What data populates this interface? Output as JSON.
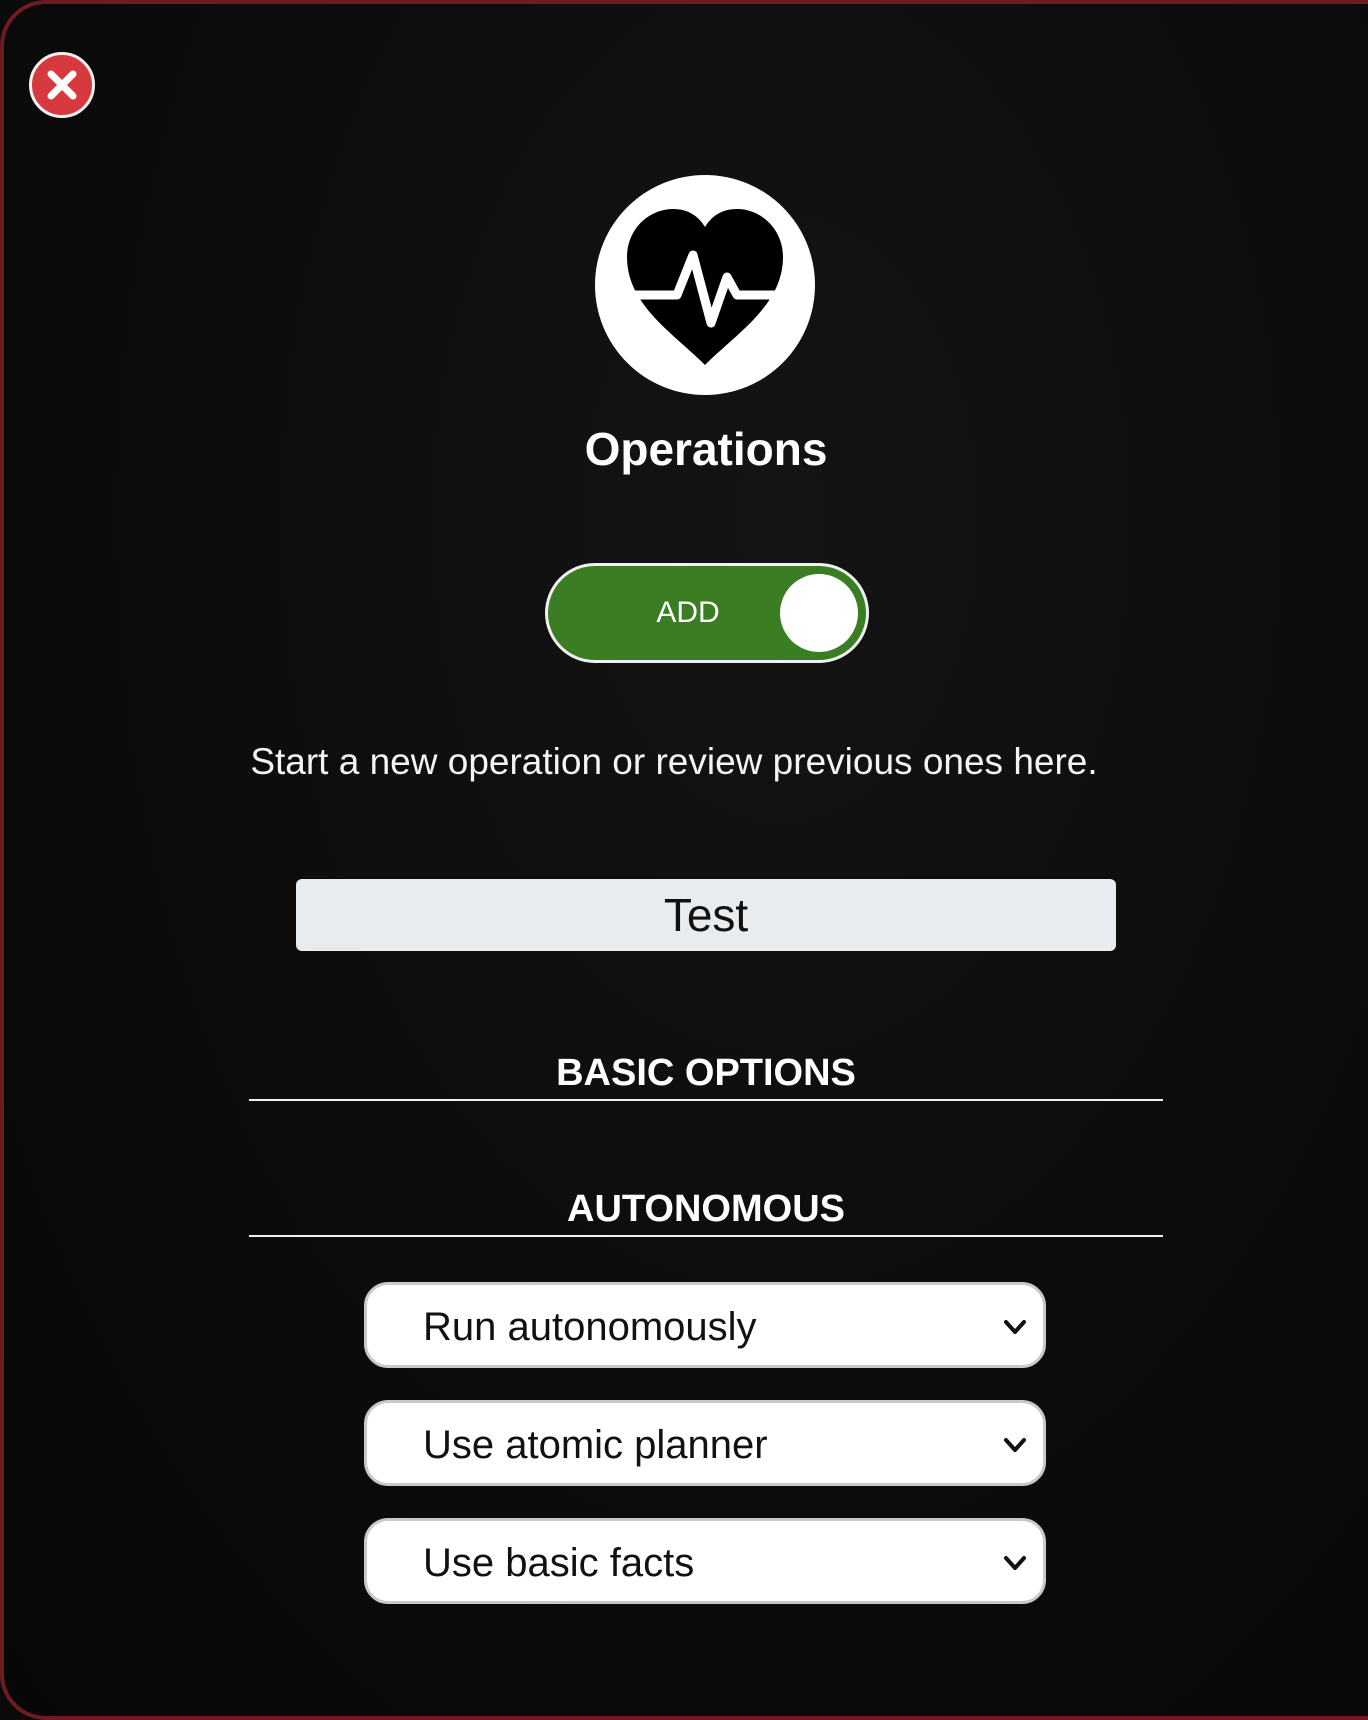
{
  "panel": {
    "title": "Operations",
    "subtitle": "Start a new operation or review previous ones here.",
    "close_icon": "close-icon",
    "hero_icon": "heartbeat-icon",
    "accent_color": "#3a7d23",
    "close_color": "#d8393f"
  },
  "toggle": {
    "label": "ADD",
    "state": "on"
  },
  "name_input": {
    "value": "Test"
  },
  "sections": {
    "basic": "BASIC OPTIONS",
    "autonomous": "AUTONOMOUS"
  },
  "selects": [
    {
      "selected": "Run autonomously"
    },
    {
      "selected": "Use atomic planner"
    },
    {
      "selected": "Use basic facts"
    }
  ]
}
